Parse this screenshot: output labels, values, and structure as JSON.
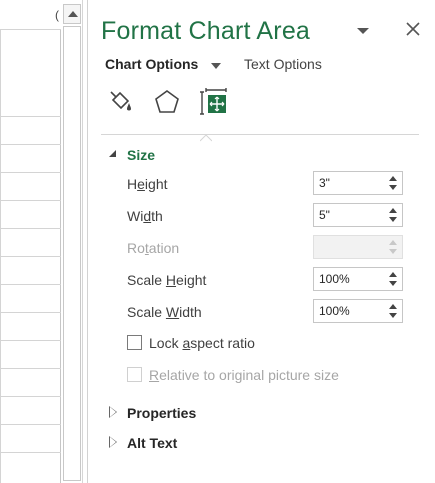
{
  "sheet": {
    "column_header_partial": "("
  },
  "pane": {
    "title": "Format Chart Area",
    "tabs": {
      "chart_options": "Chart Options",
      "text_options": "Text Options"
    },
    "icons": [
      "fill-line-icon",
      "effects-icon",
      "size-properties-icon"
    ],
    "accent_color": "#217346",
    "sections": {
      "size": {
        "label": "Size",
        "height": {
          "label": "Height",
          "value": "3\""
        },
        "width": {
          "label": "Width",
          "value": "5\""
        },
        "rotation": {
          "label": "Rotation",
          "value": ""
        },
        "scale_height": {
          "label": "Scale Height",
          "value": "100%"
        },
        "scale_width": {
          "label": "Scale Width",
          "value": "100%"
        },
        "lock_aspect": {
          "label": "Lock aspect ratio",
          "checked": false
        },
        "relative_original": {
          "label": "Relative to original picture size",
          "checked": false,
          "disabled": true
        }
      },
      "properties": {
        "label": "Properties"
      },
      "alt_text": {
        "label": "Alt Text"
      }
    }
  }
}
